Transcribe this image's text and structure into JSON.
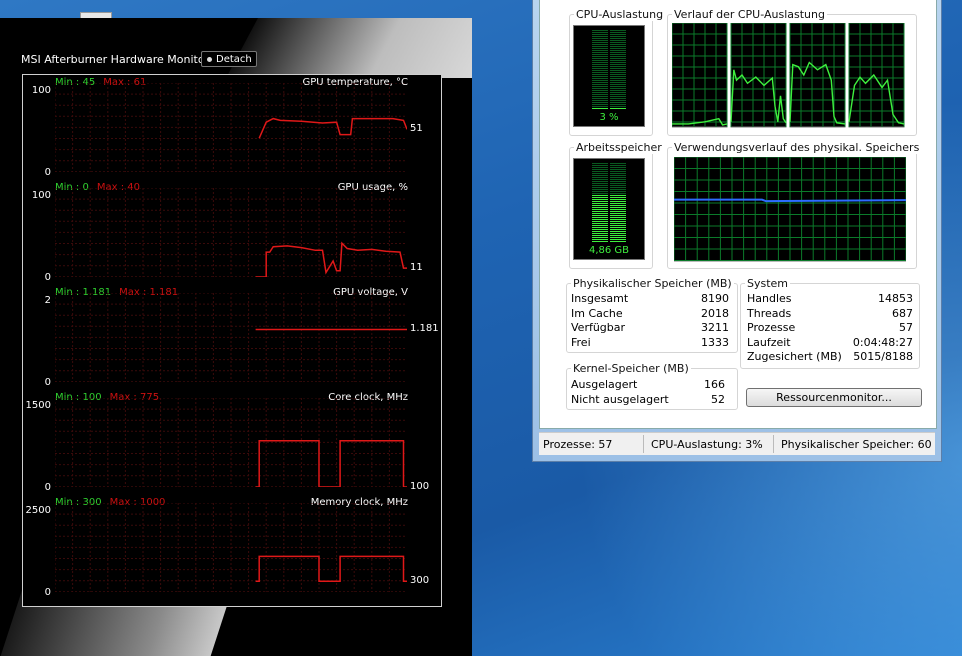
{
  "msi": {
    "title": "MSI Afterburner Hardware Monitor",
    "detach_label": "Detach",
    "graphs": [
      {
        "name": "GPU temperature, °C",
        "min_label": "Min : 45",
        "max_label": "Max : 61",
        "ymax": "100",
        "ymin": "0",
        "current": "51",
        "trace": [
          [
            0.0,
            null
          ],
          [
            0.57,
            null
          ],
          [
            0.58,
            0.38
          ],
          [
            0.6,
            0.56
          ],
          [
            0.62,
            0.6
          ],
          [
            0.64,
            0.58
          ],
          [
            0.7,
            0.57
          ],
          [
            0.76,
            0.55
          ],
          [
            0.8,
            0.56
          ],
          [
            0.81,
            0.42
          ],
          [
            0.84,
            0.42
          ],
          [
            0.845,
            0.6
          ],
          [
            0.88,
            0.6
          ],
          [
            0.92,
            0.6
          ],
          [
            0.96,
            0.6
          ],
          [
            0.99,
            0.58
          ],
          [
            1.0,
            0.48
          ]
        ]
      },
      {
        "name": "GPU usage, %",
        "min_label": "Min : 0",
        "max_label": "Max : 40",
        "ymax": "100",
        "ymin": "0",
        "current": "11",
        "trace": [
          [
            0.57,
            0.0
          ],
          [
            0.6,
            0.0
          ],
          [
            0.6,
            0.28
          ],
          [
            0.61,
            0.28
          ],
          [
            0.62,
            0.34
          ],
          [
            0.66,
            0.35
          ],
          [
            0.7,
            0.33
          ],
          [
            0.74,
            0.3
          ],
          [
            0.76,
            0.3
          ],
          [
            0.77,
            0.05
          ],
          [
            0.79,
            0.18
          ],
          [
            0.8,
            0.07
          ],
          [
            0.81,
            0.07
          ],
          [
            0.815,
            0.38
          ],
          [
            0.83,
            0.32
          ],
          [
            0.86,
            0.3
          ],
          [
            0.9,
            0.31
          ],
          [
            0.94,
            0.29
          ],
          [
            0.98,
            0.28
          ],
          [
            0.99,
            0.1
          ],
          [
            1.0,
            0.1
          ]
        ]
      },
      {
        "name": "GPU voltage, V",
        "min_label": "Min : 1.181",
        "max_label": "Max : 1.181",
        "ymax": "2",
        "ymin": "0",
        "current": "1.181",
        "trace": [
          [
            0.57,
            0.59
          ],
          [
            1.0,
            0.59
          ]
        ]
      },
      {
        "name": "Core clock, MHz",
        "min_label": "Min : 100",
        "max_label": "Max : 775",
        "ymax": "1500",
        "ymin": "0",
        "current": "100",
        "trace": [
          [
            0.57,
            0.0
          ],
          [
            0.58,
            0.0
          ],
          [
            0.58,
            0.52
          ],
          [
            0.75,
            0.52
          ],
          [
            0.75,
            0.0
          ],
          [
            0.81,
            0.0
          ],
          [
            0.81,
            0.52
          ],
          [
            0.99,
            0.52
          ],
          [
            0.99,
            0.0
          ],
          [
            1.0,
            0.0
          ]
        ]
      },
      {
        "name": "Memory clock, MHz",
        "min_label": "Min : 300",
        "max_label": "Max : 1000",
        "ymax": "2500",
        "ymin": "0",
        "current": "300",
        "trace": [
          [
            0.57,
            0.12
          ],
          [
            0.58,
            0.12
          ],
          [
            0.58,
            0.4
          ],
          [
            0.75,
            0.4
          ],
          [
            0.75,
            0.12
          ],
          [
            0.81,
            0.12
          ],
          [
            0.81,
            0.4
          ],
          [
            0.99,
            0.4
          ],
          [
            0.99,
            0.12
          ],
          [
            1.0,
            0.12
          ]
        ]
      }
    ]
  },
  "taskmgr": {
    "cpu_label": "CPU-Auslastung",
    "cpu_value": "3 %",
    "cpu_fraction": 0.03,
    "cpu_history_label": "Verlauf der CPU-Auslastung",
    "mem_label": "Arbeitsspeicher",
    "mem_value": "4,86 GB",
    "mem_fraction": 0.59,
    "mem_history_label": "Verwendungsverlauf des physikal. Speichers",
    "physical": {
      "label": "Physikalischer Speicher (MB)",
      "rows": [
        {
          "k": "Insgesamt",
          "v": "8190"
        },
        {
          "k": "Im Cache",
          "v": "2018"
        },
        {
          "k": "Verfügbar",
          "v": "3211"
        },
        {
          "k": "Frei",
          "v": "1333"
        }
      ]
    },
    "kernel": {
      "label": "Kernel-Speicher (MB)",
      "rows": [
        {
          "k": "Ausgelagert",
          "v": "166"
        },
        {
          "k": "Nicht ausgelagert",
          "v": "52"
        }
      ]
    },
    "system": {
      "label": "System",
      "rows": [
        {
          "k": "Handles",
          "v": "14853"
        },
        {
          "k": "Threads",
          "v": "687"
        },
        {
          "k": "Prozesse",
          "v": "57"
        },
        {
          "k": "Laufzeit",
          "v": "0:04:48:27"
        },
        {
          "k": "Zugesichert (MB)",
          "v": "5015/8188"
        }
      ]
    },
    "resource_button": "Ressourcenmonitor...",
    "status": {
      "processes": "Prozesse: 57",
      "cpu": "CPU-Auslastung: 3%",
      "mem": "Physikalischer Speicher: 60"
    },
    "colors": {
      "graph_green": "#3eef3e",
      "grid": "#0b7a2a",
      "mem_line": "#2d6cff",
      "msi_line": "#e01818",
      "msi_grid": "#3a0a0a"
    }
  }
}
